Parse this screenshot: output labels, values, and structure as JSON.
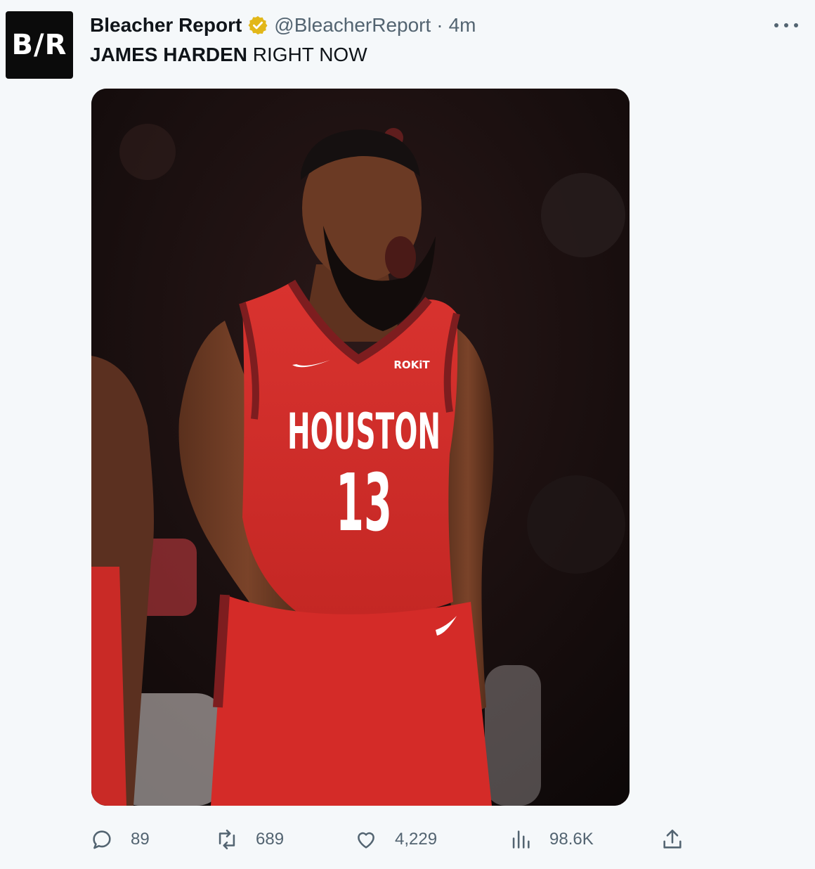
{
  "account": {
    "avatar_text": "B/R",
    "name": "Bleacher Report",
    "handle": "@BleacherReport",
    "separator": "·",
    "time": "4m",
    "verified_color": "#e2b719"
  },
  "tweet": {
    "text_bold": "JAMES HARDEN",
    "text_rest": " RIGHT NOW"
  },
  "media": {
    "jersey_city": "HOUSTON",
    "jersey_number": "13",
    "jersey_sponsor": "ROKiT",
    "jersey_color": "#d7302e"
  },
  "actions": {
    "replies": "89",
    "retweets": "689",
    "likes": "4,229",
    "views": "98.6K"
  },
  "icons": [
    "verified-badge-icon",
    "more-icon",
    "reply-icon",
    "retweet-icon",
    "like-icon",
    "views-icon",
    "share-icon"
  ]
}
